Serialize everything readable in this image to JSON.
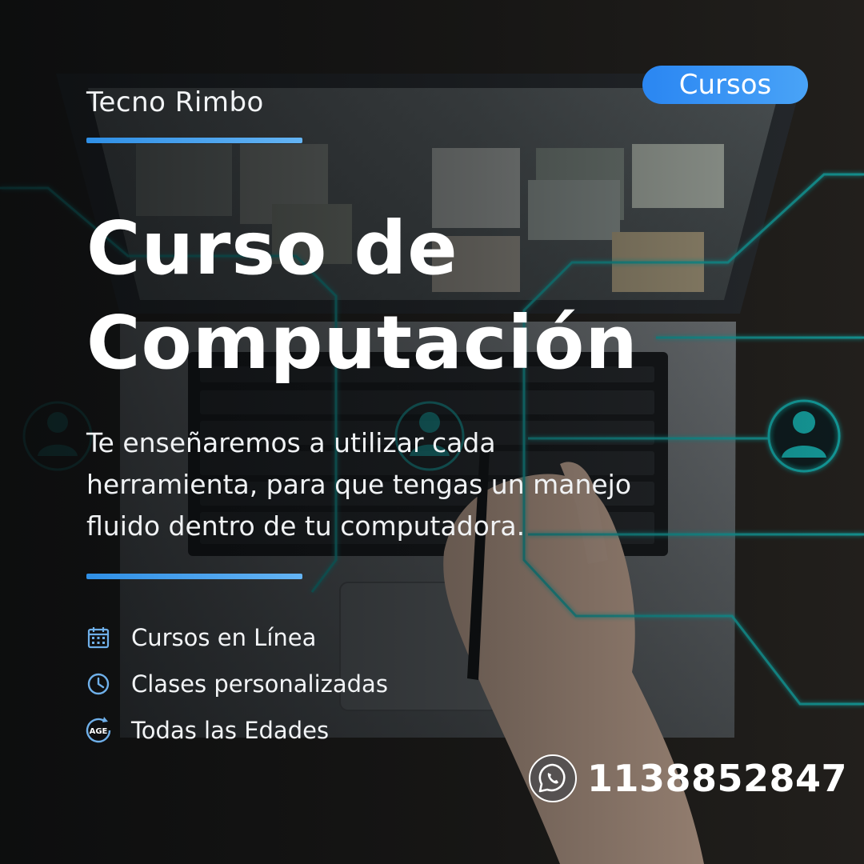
{
  "brand": {
    "name": "Tecno Rimbo"
  },
  "badge": {
    "label": "Cursos"
  },
  "headline": {
    "line1": "Curso de",
    "line2": "Computación"
  },
  "description": {
    "line1": "Te enseñaremos a utilizar cada",
    "line2": "herramienta, para que tengas un manejo",
    "line3": "fluido dentro de tu computadora."
  },
  "features": [
    {
      "label": "Cursos en Línea",
      "icon": "calendar-icon"
    },
    {
      "label": "Clases personalizadas",
      "icon": "clock-icon"
    },
    {
      "label": "Todas las Edades",
      "icon": "age-icon",
      "icon_text": "AGE"
    }
  ],
  "contact": {
    "phone": "1138852847",
    "icon": "whatsapp-icon"
  },
  "colors": {
    "accent_blue": "#2f8fe6",
    "network_cyan": "#19c8c6",
    "text": "#ffffff"
  }
}
